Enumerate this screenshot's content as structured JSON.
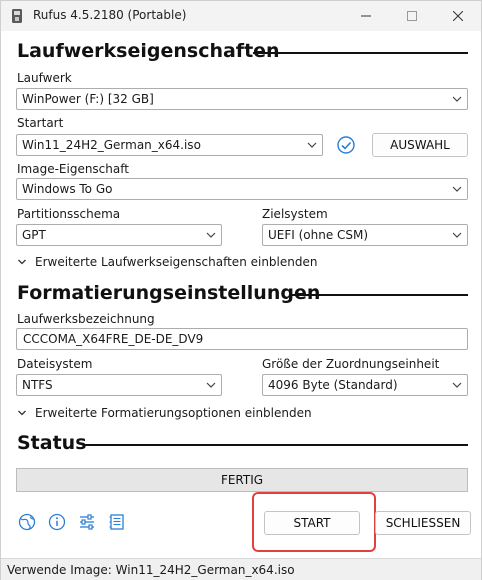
{
  "window": {
    "title": "Rufus 4.5.2180 (Portable)"
  },
  "drive_properties": {
    "heading": "Laufwerkseigenschaften",
    "device_label": "Laufwerk",
    "device_value": "WinPower (F:) [32 GB]",
    "boot_label": "Startart",
    "boot_value": "Win11_24H2_German_x64.iso",
    "select_button": "AUSWAHL",
    "image_option_label": "Image-Eigenschaft",
    "image_option_value": "Windows To Go",
    "partition_label": "Partitionsschema",
    "partition_value": "GPT",
    "target_label": "Zielsystem",
    "target_value": "UEFI (ohne CSM)",
    "advanced_toggle": "Erweiterte Laufwerkseigenschaften einblenden"
  },
  "format_options": {
    "heading": "Formatierungseinstellungen",
    "volume_label_label": "Laufwerksbezeichnung",
    "volume_label_value": "CCCOMA_X64FRE_DE-DE_DV9",
    "filesystem_label": "Dateisystem",
    "filesystem_value": "NTFS",
    "cluster_label": "Größe der Zuordnungseinheit",
    "cluster_value": "4096 Byte (Standard)",
    "advanced_toggle": "Erweiterte Formatierungsoptionen einblenden"
  },
  "status": {
    "heading": "Status",
    "progress_text": "FERTIG",
    "progress_fraction": 1.0
  },
  "actions": {
    "start_label": "START",
    "close_label": "SCHLIESSEN"
  },
  "statusbar": {
    "text": "Verwende Image: Win11_24H2_German_x64.iso"
  },
  "icons": [
    "globe-icon",
    "info-icon",
    "settings-sliders-icon",
    "log-icon",
    "verified-check-icon",
    "chevron-down-icon"
  ],
  "colors": {
    "highlight": "#e0403f",
    "accent": "#2b7fd4"
  }
}
